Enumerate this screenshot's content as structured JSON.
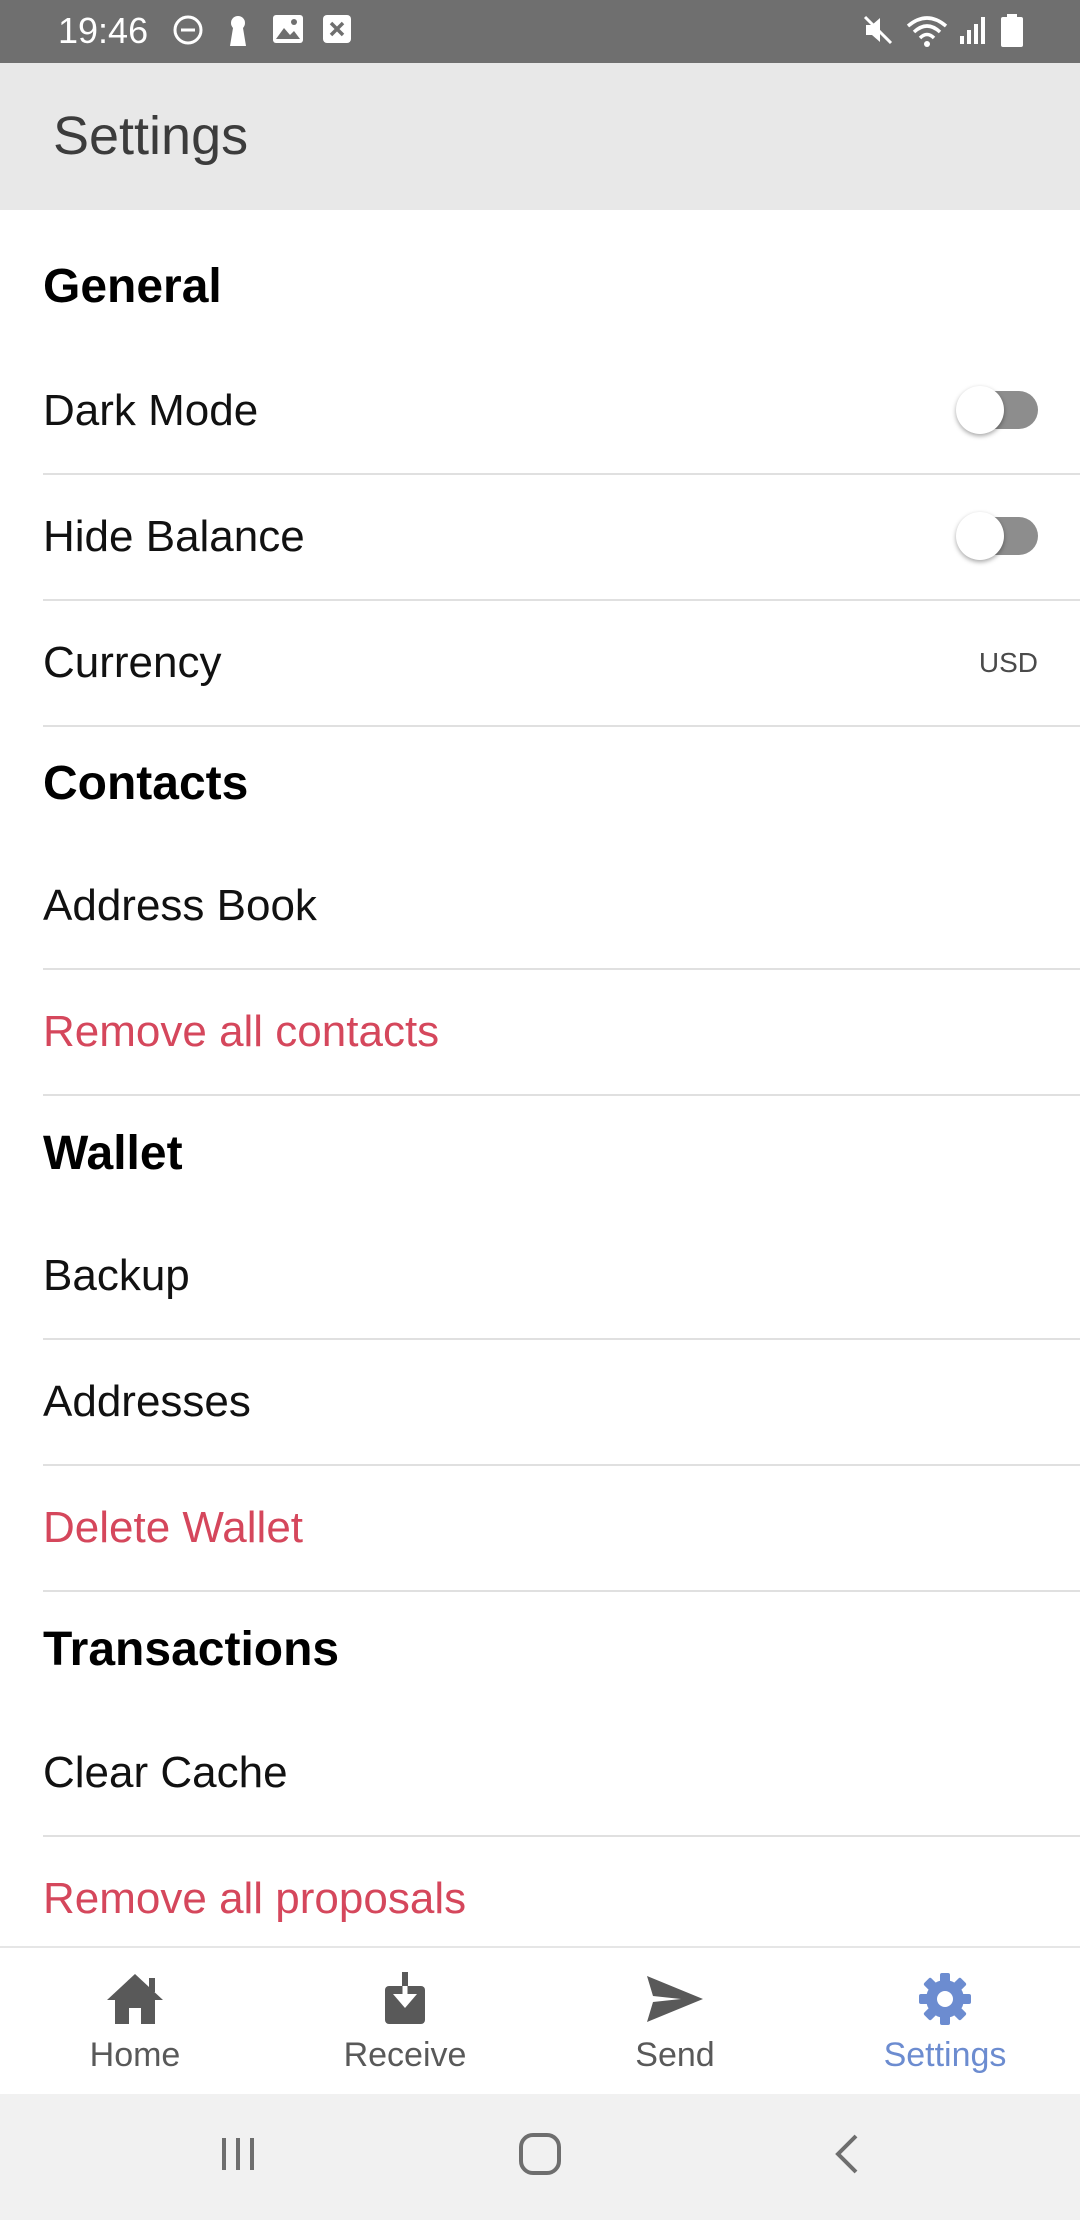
{
  "status_bar": {
    "time": "19:46",
    "left_icons": [
      "do-not-disturb-icon",
      "keyhole-icon",
      "image-icon",
      "close-box-icon"
    ],
    "right_icons": [
      "mute-icon",
      "wifi-icon",
      "signal-icon",
      "battery-icon"
    ]
  },
  "app_bar": {
    "title": "Settings"
  },
  "sections": {
    "general": {
      "title": "General",
      "dark_mode": {
        "label": "Dark Mode",
        "enabled": false
      },
      "hide_balance": {
        "label": "Hide Balance",
        "enabled": false
      },
      "currency": {
        "label": "Currency",
        "value": "USD"
      }
    },
    "contacts": {
      "title": "Contacts",
      "address_book": "Address Book",
      "remove_all_contacts": "Remove all contacts"
    },
    "wallet": {
      "title": "Wallet",
      "backup": "Backup",
      "addresses": "Addresses",
      "delete_wallet": "Delete Wallet"
    },
    "transactions": {
      "title": "Transactions",
      "clear_cache": "Clear Cache",
      "remove_all_proposals": "Remove all proposals"
    }
  },
  "bottom_nav": {
    "home": "Home",
    "receive": "Receive",
    "send": "Send",
    "settings": "Settings",
    "active": "settings"
  },
  "colors": {
    "danger": "#d5475c",
    "active_nav": "#6c8cd0",
    "app_bar": "#e8e8e8",
    "status_bar": "#6f6f6f"
  }
}
